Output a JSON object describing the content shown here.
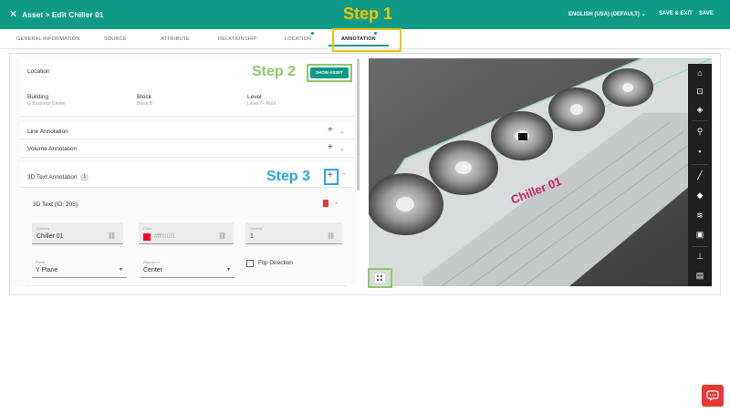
{
  "header": {
    "close_icon": "close-icon",
    "title": "Asset > Edit Chiller 01",
    "language": "ENGLISH (USA) (DEFAULT)",
    "save_exit": "SAVE & EXIT",
    "save": "SAVE",
    "color": "#0e9a86"
  },
  "steps": {
    "step1": "Step 1",
    "step2": "Step 2",
    "step3": "Step 3"
  },
  "tabs": [
    {
      "label": "GENERAL INFORMATION"
    },
    {
      "label": "SOURCE"
    },
    {
      "label": "ATTRIBUTE"
    },
    {
      "label": "RELATIONSHIP"
    },
    {
      "label": "LOCATION"
    },
    {
      "label": "ANNOTATION"
    }
  ],
  "location": {
    "title": "Location",
    "show_asset": "SHOW ASSET",
    "building_label": "Building",
    "building_value": "G Business Center",
    "block_label": "Block",
    "block_value": "Block B",
    "level_label": "Level",
    "level_value": "Level 7 - Roof"
  },
  "annotations": {
    "line": "Line Annotation",
    "volume": "Volume Annotation",
    "text3d": "3D Text Annotation",
    "text3d_count": "1"
  },
  "text_item": {
    "title": "3D Text (ID: 205)",
    "content_label": "Content",
    "content_value": "Chiller 01",
    "color_label": "Color",
    "color_value": "#ff0021",
    "opacity_label": "Opacity",
    "opacity_value": "1",
    "plane_label": "Plane",
    "plane_value": "Y Plane",
    "alignment_label": "Alignment",
    "alignment_value": "Center",
    "flip_label": "Flip Direction"
  },
  "viewer": {
    "label_text": "Chiller 01",
    "toolbar_icons": [
      "home-icon",
      "fit-view-icon",
      "render-mode-icon",
      "walk-mode-icon",
      "camera-icon",
      "measure-icon",
      "section-icon",
      "layers-icon",
      "model-icon",
      "hierarchy-icon",
      "properties-icon"
    ]
  }
}
